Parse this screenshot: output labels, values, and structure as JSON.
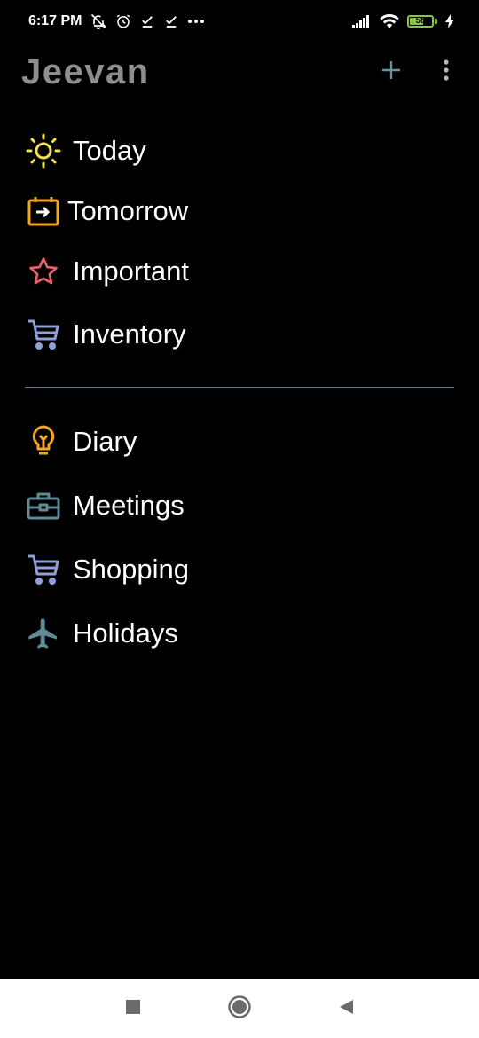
{
  "status_bar": {
    "time": "6:17 PM",
    "battery_level": "58",
    "battery_color": "#8bc34a",
    "icons": [
      "notifications-off-icon",
      "alarm-icon",
      "download-done-icon",
      "download-done-icon",
      "more-horiz-icon",
      "signal-icon",
      "wifi-icon",
      "battery-icon",
      "charging-icon"
    ]
  },
  "header": {
    "title": "Jeevan",
    "title_color": "#8e8e8e",
    "accent_color": "#6a8fa3",
    "actions": [
      "add-icon",
      "more-vert-icon"
    ]
  },
  "smart_lists": [
    {
      "label": "Today",
      "icon": "sun-icon",
      "color": "#f4e04d"
    },
    {
      "label": "Tomorrow",
      "icon": "calendar-arrow-icon",
      "color": "#f5a623"
    },
    {
      "label": "Important",
      "icon": "star-icon",
      "color": "#e8626b"
    },
    {
      "label": "Inventory",
      "icon": "cart-icon",
      "color": "#8f9fd8"
    }
  ],
  "user_lists": [
    {
      "label": "Diary",
      "icon": "lightbulb-icon",
      "color": "#f5a623"
    },
    {
      "label": "Meetings",
      "icon": "briefcase-icon",
      "color": "#5f8a96"
    },
    {
      "label": "Shopping",
      "icon": "cart-icon",
      "color": "#8f9fd8"
    },
    {
      "label": "Holidays",
      "icon": "airplane-icon",
      "color": "#5f8a96"
    }
  ],
  "nav_bar": {
    "buttons": [
      "recents-icon",
      "home-icon",
      "back-icon"
    ]
  }
}
